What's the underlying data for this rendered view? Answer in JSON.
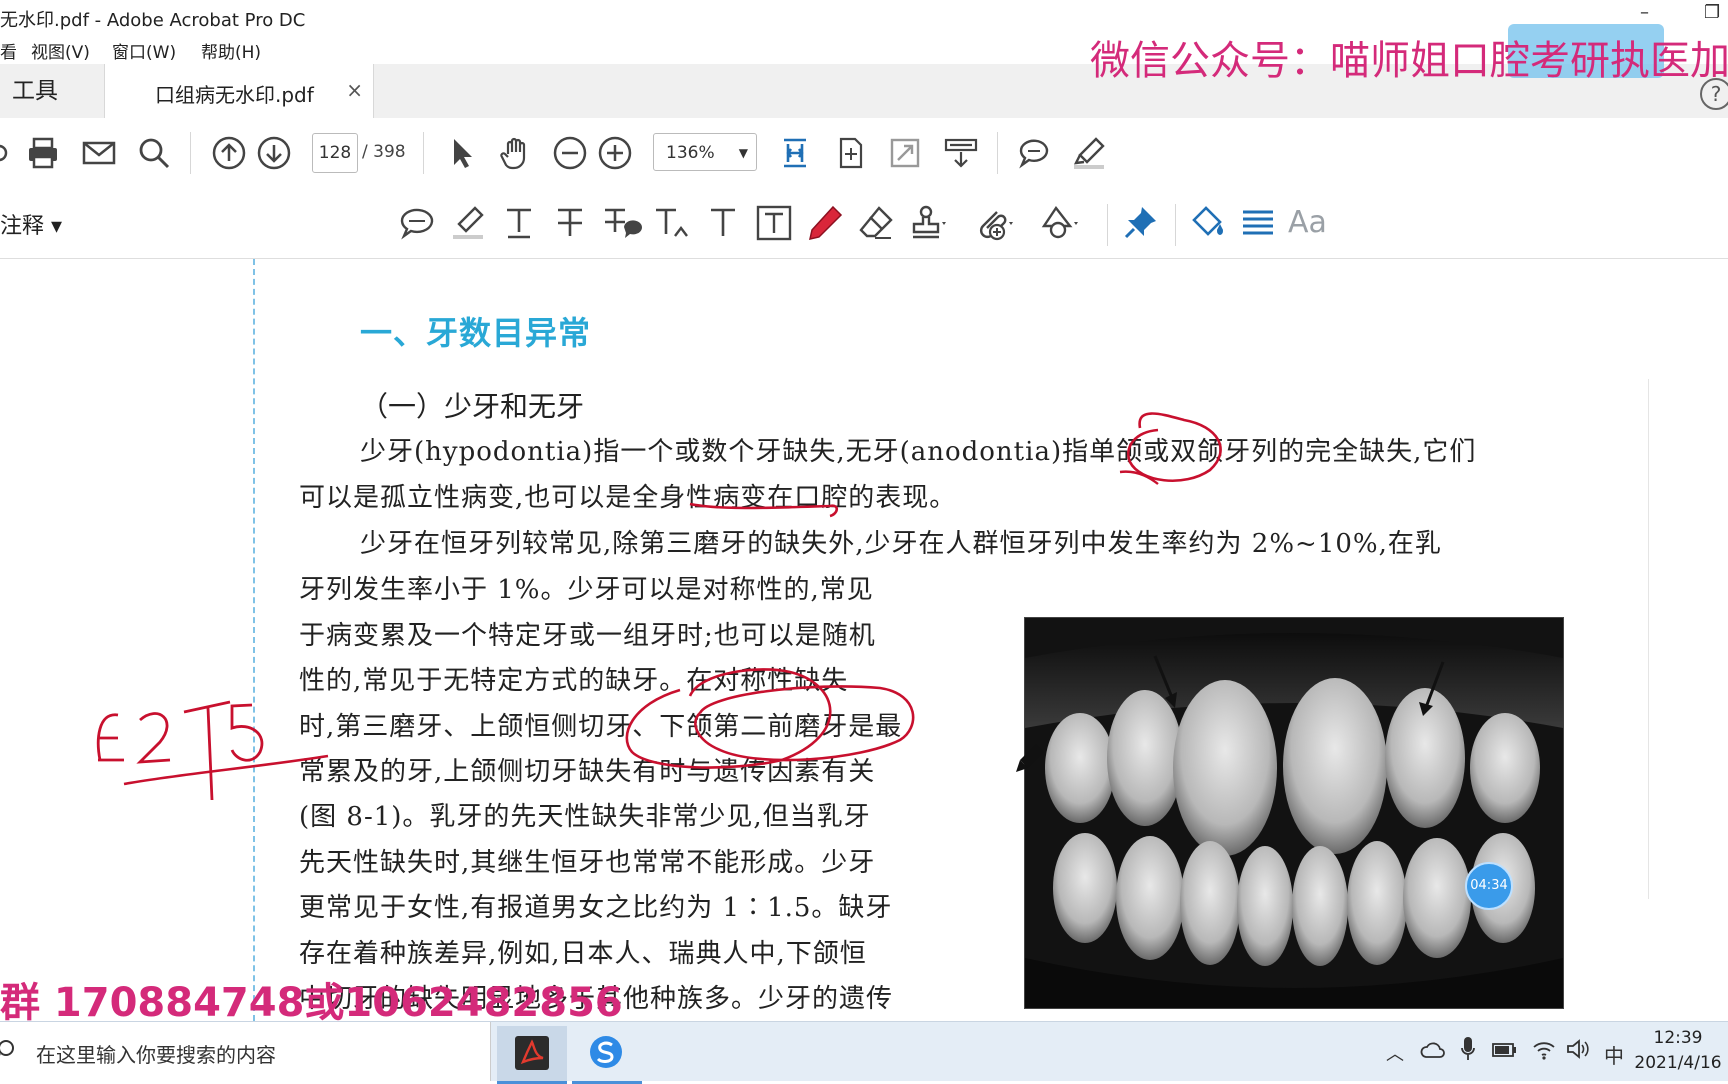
{
  "window": {
    "title": "无水印.pdf - Adobe Acrobat Pro DC",
    "minimize_glyph": "–",
    "restore_glyph": "❐"
  },
  "menu": {
    "items": [
      "看",
      "视图(V)",
      "窗口(W)",
      "帮助(H)"
    ]
  },
  "tabs": {
    "tools_label": "工具",
    "doc_label": "口组病无水印.pdf",
    "close_glyph": "×"
  },
  "toolbar": {
    "current_page": "128",
    "total_pages": "/ 398",
    "zoom": "136%",
    "zoom_arrow": "▼",
    "icons": [
      "share-icon",
      "print-icon",
      "email-icon",
      "search-icon",
      "prev-page-icon",
      "next-page-icon",
      "select-cursor-icon",
      "hand-icon",
      "zoom-out-icon",
      "zoom-in-icon",
      "fit-page-icon",
      "rotate-icon",
      "fullscreen-icon",
      "scroll-mode-icon",
      "comment-icon",
      "highlight-icon"
    ]
  },
  "commentbar": {
    "label": "注释 ▾",
    "text_aa": "Aa"
  },
  "document": {
    "heading1": "一、牙数目异常",
    "heading2": "（一）少牙和无牙",
    "lines": [
      "少牙(hypodontia)指一个或数个牙缺失,无牙(anodontia)指单颌或双颌牙列的完全缺失,它们",
      "可以是孤立性病变,也可以是全身性病变在口腔的表现。",
      "少牙在恒牙列较常见,除第三磨牙的缺失外,少牙在人群恒牙列中发生率约为 2%~10%,在乳",
      "牙列发生率小于 1%。少牙可以是对称性的,常见",
      "于病变累及一个特定牙或一组牙时;也可以是随机",
      "性的,常见于无特定方式的缺牙。在对称性缺失",
      "时,第三磨牙、上颌恒侧切牙、下颌第二前磨牙是最",
      "常累及的牙,上颌侧切牙缺失有时与遗传因素有关",
      "(图 8-1)。乳牙的先天性缺失非常少见,但当乳牙",
      "先天性缺失时,其继生恒牙也常常不能形成。少牙",
      "更常见于女性,有报道男女之比约为 1∶1.5。缺牙",
      "存在着种族差异,例如,日本人、瑞典人中,下颌恒",
      "中切牙的缺失明显地多于其他种族多。少牙的遗传"
    ],
    "handwriting": "E2T5"
  },
  "watermarks": {
    "top": "微信公众号：喵师姐口腔考研执医加",
    "bottom": "群  170884748或1062482856"
  },
  "overlay": {
    "timer": "04:34",
    "help_glyph": "?"
  },
  "taskbar": {
    "search_placeholder": "在这里输入你要搜索的内容",
    "ime": "中",
    "time": "12:39",
    "date": "2021/4/16"
  },
  "colors": {
    "heading_blue": "#29a8d6",
    "ink_red": "#c8102e",
    "watermark_pink": "#d42a7a"
  }
}
